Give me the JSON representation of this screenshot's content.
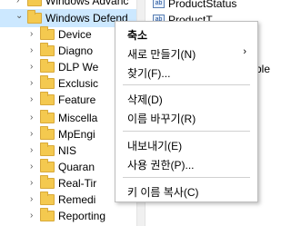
{
  "tree": {
    "items": [
      {
        "label": "Windows Advanc",
        "chevron": "›",
        "selected": false
      },
      {
        "label": "Windows Defend",
        "chevron": "⌄",
        "selected": true
      },
      {
        "label": "Device",
        "chevron": "›",
        "selected": false
      },
      {
        "label": "Diagno",
        "chevron": "›",
        "selected": false
      },
      {
        "label": "DLP We",
        "chevron": "›",
        "selected": false
      },
      {
        "label": "Exclusic",
        "chevron": "›",
        "selected": false
      },
      {
        "label": "Feature",
        "chevron": "›",
        "selected": false
      },
      {
        "label": "Miscella",
        "chevron": "›",
        "selected": false
      },
      {
        "label": "MpEngi",
        "chevron": "›",
        "selected": false
      },
      {
        "label": "NIS",
        "chevron": "›",
        "selected": false
      },
      {
        "label": "Quaran",
        "chevron": "›",
        "selected": false
      },
      {
        "label": "Real-Tir",
        "chevron": "›",
        "selected": false
      },
      {
        "label": "Remedi",
        "chevron": "›",
        "selected": false
      },
      {
        "label": "Reporting",
        "chevron": "›",
        "selected": false
      }
    ]
  },
  "values": {
    "items": [
      {
        "label": "ProductStatus",
        "icon": "ab"
      },
      {
        "label": "ProductT",
        "icon": "ab"
      },
      {
        "label": "table",
        "icon": ""
      }
    ]
  },
  "context_menu": {
    "items": [
      {
        "label": "축소",
        "bold": true,
        "submenu": false
      },
      {
        "label": "새로 만들기(N)",
        "bold": false,
        "submenu": true,
        "arrow": "›"
      },
      {
        "label": "찾기(F)...",
        "bold": false,
        "submenu": false
      },
      {
        "label": "삭제(D)",
        "bold": false,
        "submenu": false
      },
      {
        "label": "이름 바꾸기(R)",
        "bold": false,
        "submenu": false
      },
      {
        "label": "내보내기(E)",
        "bold": false,
        "submenu": false
      },
      {
        "label": "사용 권한(P)...",
        "bold": false,
        "submenu": false
      },
      {
        "label": "키 이름 복사(C)",
        "bold": false,
        "submenu": false
      }
    ]
  },
  "colors": {
    "selected_row": "#cce8ff",
    "folder": "#f4c94f"
  }
}
